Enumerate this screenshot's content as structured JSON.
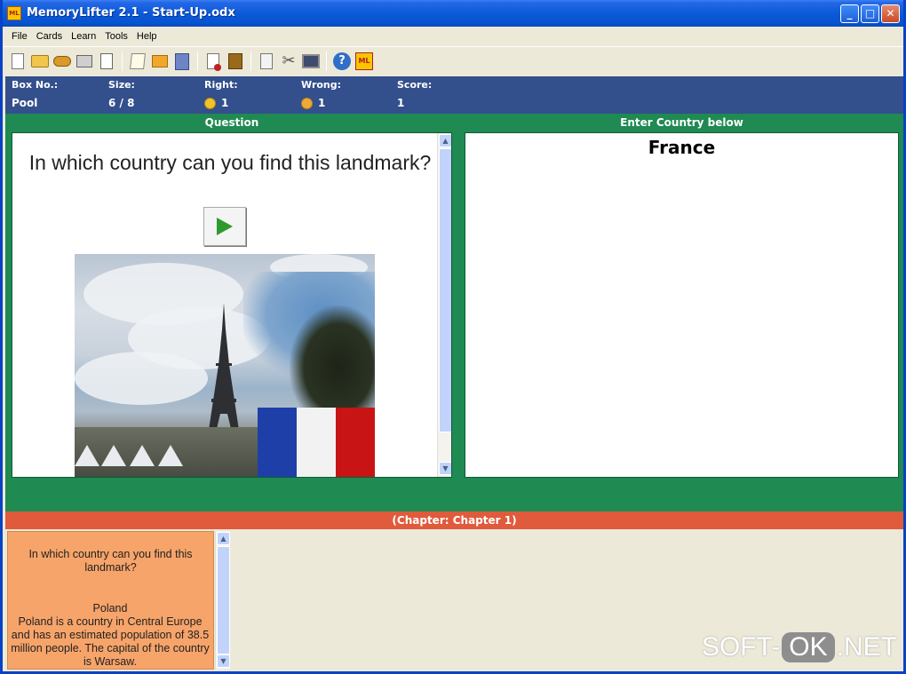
{
  "window": {
    "title": "MemoryLifter 2.1 - Start-Up.odx",
    "app_icon_text": "ML"
  },
  "window_buttons": {
    "minimize": "_",
    "maximize": "□",
    "close": "✕"
  },
  "menu": [
    "File",
    "Cards",
    "Learn",
    "Tools",
    "Help"
  ],
  "toolbar": {
    "icons": [
      "new-file-icon",
      "open-folder-icon",
      "save-icon",
      "print-icon",
      "print-preview-icon",
      "edit-icon",
      "folder-icon",
      "book-icon",
      "card-icon",
      "box-icon",
      "document-icon",
      "tools-icon",
      "monitor-icon",
      "help-icon",
      "memorylifter-icon"
    ],
    "help_glyph": "?",
    "ml_glyph": "ML"
  },
  "stats": {
    "box_no": {
      "label": "Box No.:",
      "value": "Pool"
    },
    "size": {
      "label": "Size:",
      "value": "6 / 8"
    },
    "right": {
      "label": "Right:",
      "value": "1"
    },
    "wrong": {
      "label": "Wrong:",
      "value": "1"
    },
    "score": {
      "label": "Score:",
      "value": "1"
    }
  },
  "question": {
    "title": "Question",
    "text": "In which country can you find this landmark?"
  },
  "answer": {
    "title": "Enter Country below",
    "value": "France"
  },
  "flag_colors": [
    "#1f3fa8",
    "#f2f2f2",
    "#c81414"
  ],
  "chapter": {
    "label": "(Chapter: Chapter 1)"
  },
  "card_preview": {
    "question": "In which country can you find this landmark?",
    "answer_title": "Poland",
    "answer_text": "Poland is a country in Central Europe and has an estimated population of 38.5 million people. The capital of the country is Warsaw."
  },
  "scroll_arrows": {
    "up": "▲",
    "down": "▼"
  },
  "watermark": {
    "part1": "SOFT-",
    "part2": "OK",
    "part3": ".NET"
  }
}
